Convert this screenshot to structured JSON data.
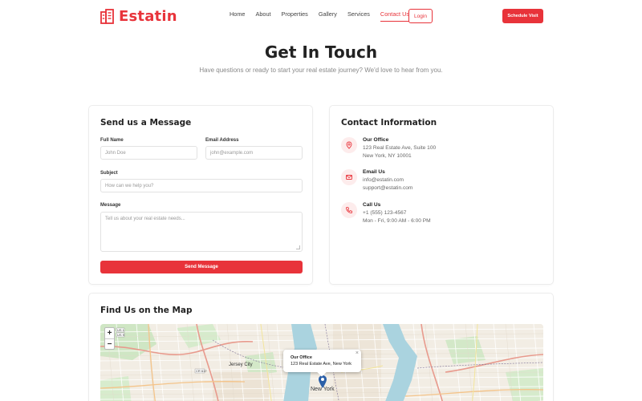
{
  "brand": {
    "name": "Estatin",
    "accent": "#e8333a"
  },
  "nav": {
    "items": [
      "Home",
      "About",
      "Properties",
      "Gallery",
      "Services",
      "Contact Us"
    ],
    "active": "Contact Us",
    "login": "Login",
    "schedule": "Schedule Visit"
  },
  "hero": {
    "title": "Get In Touch",
    "subtitle": "Have questions or ready to start your real estate journey? We'd love to hear from you."
  },
  "form": {
    "title": "Send us a Message",
    "full_name_label": "Full Name",
    "full_name_placeholder": "John Doe",
    "email_label": "Email Address",
    "email_placeholder": "john@example.com",
    "subject_label": "Subject",
    "subject_placeholder": "How can we help you?",
    "message_label": "Message",
    "message_placeholder": "Tell us about your real estate needs...",
    "send_label": "Send Message"
  },
  "contact": {
    "title": "Contact Information",
    "office_title": "Our Office",
    "office_line1": "123 Real Estate Ave, Suite 100",
    "office_line2": "New York, NY 10001",
    "email_title": "Email Us",
    "email_line1": "info@estatin.com",
    "email_line2": "support@estatin.com",
    "call_title": "Call Us",
    "call_line1": "+1 (555) 123-4567",
    "call_line2": "Mon - Fri, 9:00 AM - 6:00 PM"
  },
  "map": {
    "title": "Find Us on the Map",
    "zoom_in": "+",
    "zoom_out": "−",
    "popup_title": "Our Office",
    "popup_address": "123 Real Estate Ave, New York",
    "popup_close": "×",
    "label_jersey": "Jersey City",
    "label_newyork": "New York"
  }
}
